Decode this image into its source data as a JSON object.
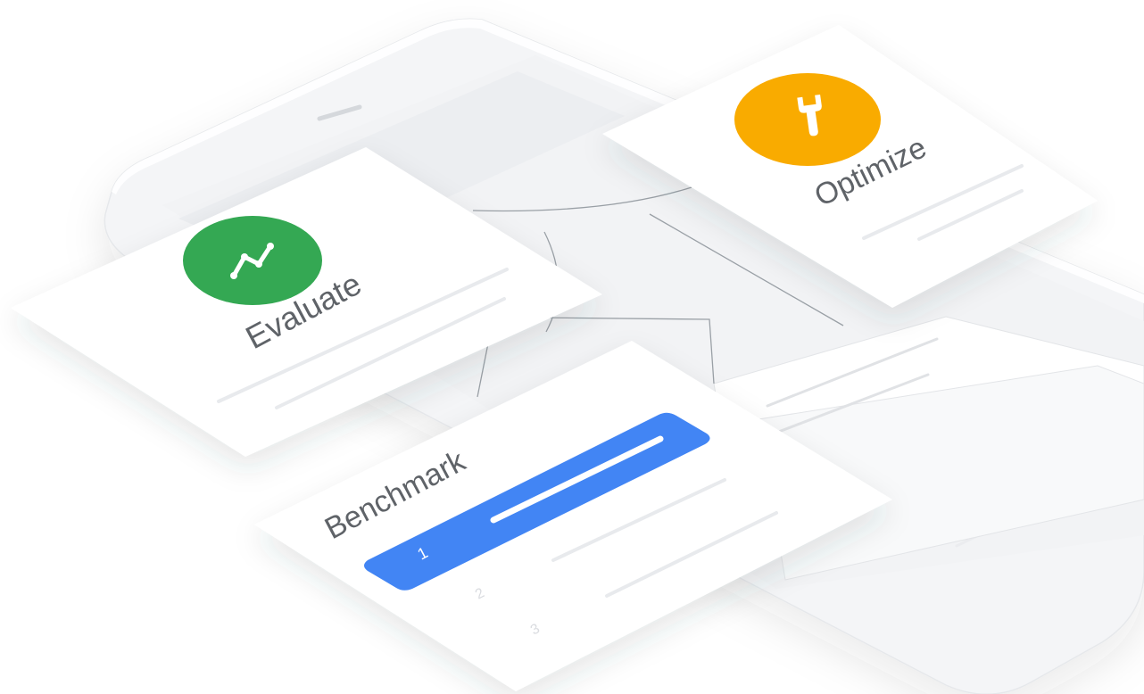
{
  "cards": {
    "evaluate": {
      "title": "Evaluate",
      "icon": "chart-trend-icon",
      "color": "#34a853"
    },
    "optimize": {
      "title": "Optimize",
      "icon": "wrench-icon",
      "color": "#f9ab00"
    },
    "benchmark": {
      "title": "Benchmark",
      "highlight_color": "#4285f4",
      "ranks": [
        "1",
        "2",
        "3"
      ]
    }
  },
  "colors": {
    "device": "#f4f5f7",
    "card": "#ffffff",
    "placeholder_line": "#e8eaed"
  }
}
